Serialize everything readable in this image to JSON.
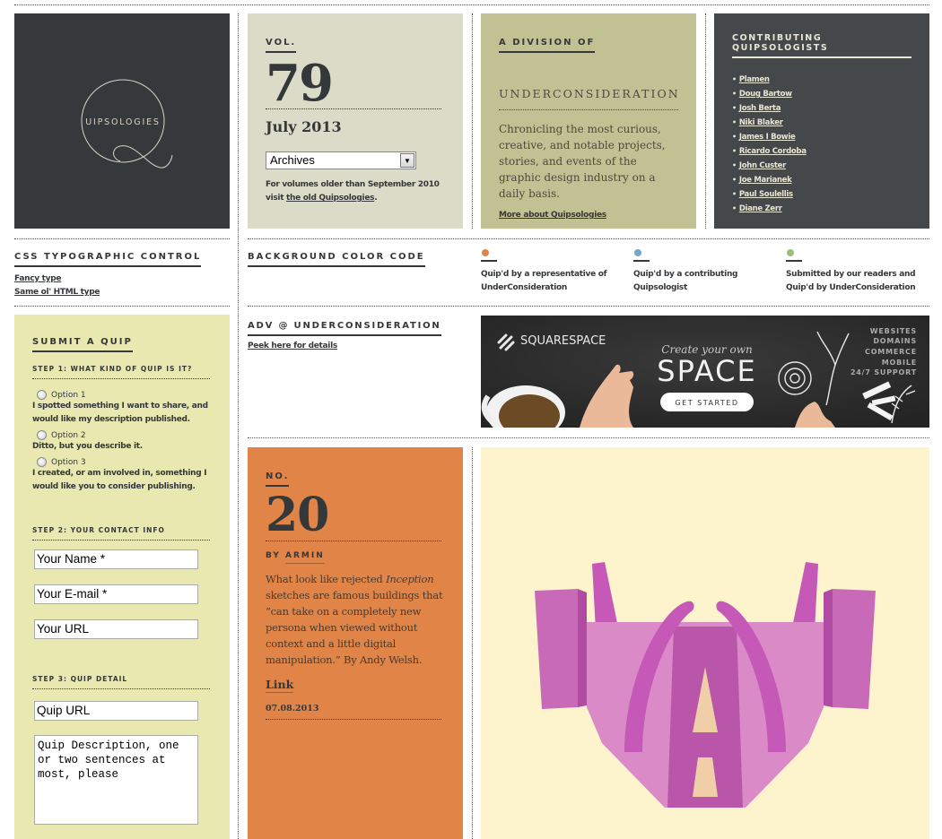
{
  "logo": {
    "text": "UIPSOLOGIES",
    "letter": "Q"
  },
  "volume": {
    "label": "VOL.",
    "number": "79",
    "month": "July 2013",
    "archives_select": {
      "selected": "Archives"
    },
    "note_prefix": "For volumes older than September 2010 visit ",
    "note_link": "the old Quipsologies",
    "note_suffix": "."
  },
  "division": {
    "label": "A DIVISION OF",
    "brand": "UNDERCONSIDERATION",
    "description": "Chronicling the most curious, creative, and notable projects, stories, and events of the graphic design industry on a daily basis.",
    "more_link": "More about Quipsologies"
  },
  "contributors": {
    "label": "CONTRIBUTING QUIPSOLOGISTS",
    "names": [
      "Plamen",
      "Doug Bartow",
      "Josh Berta",
      "Niki Blaker",
      "James I Bowie",
      "Ricardo Cordoba",
      "John Custer",
      "Joe Marianek",
      "Paul Soulellis",
      "Diane Zerr"
    ]
  },
  "css_control": {
    "label": "CSS TYPOGRAPHIC CONTROL",
    "links": [
      "Fancy type",
      "Same ol' HTML type"
    ]
  },
  "background_code": {
    "label": "BACKGROUND COLOR CODE",
    "legend": [
      {
        "color": "#e08448",
        "text": "Quip'd by a representative of UnderConsideration"
      },
      {
        "color": "#72a6cc",
        "text": "Quip'd by a contributing Quipsologist"
      },
      {
        "color": "#9fbd76",
        "text": "Submitted by our readers and Quip'd by UnderConsideration"
      }
    ]
  },
  "submit": {
    "title": "SUBMIT A QUIP",
    "step1": "STEP 1: WHAT KIND OF QUIP IS IT?",
    "options": [
      {
        "label": "Option 1",
        "desc": "I spotted something I want to share, and would like my description published."
      },
      {
        "label": "Option 2",
        "desc": "Ditto, but you describe it."
      },
      {
        "label": "Option 3",
        "desc": "I created, or am involved in, something I would like you to consider publishing."
      }
    ],
    "step2": "STEP 2: YOUR CONTACT INFO",
    "name_value": "Your Name *",
    "email_value": "Your E-mail *",
    "url_value": "Your URL",
    "step3": "STEP 3: QUIP DETAIL",
    "quip_url_value": "Quip URL",
    "quip_desc_value": "Quip Description, one or two sentences at most, please"
  },
  "advertising": {
    "label": "ADV @ UNDERCONSIDERATION",
    "link": "Peek here for details",
    "ad": {
      "brand": "SQUARESPACE",
      "tagline": "Create your own",
      "headline": "SPACE",
      "cta": "GET STARTED",
      "features": [
        "WEBSITES",
        "DOMAINS",
        "COMMERCE",
        "MOBILE",
        "24/7 SUPPORT"
      ]
    }
  },
  "post": {
    "label": "NO.",
    "number": "20",
    "by_prefix": "BY ",
    "author": "ARMIN",
    "body_1": "What look like rejected ",
    "body_em": "Inception",
    "body_2": " sketches are famous buildings that “can take on a completely new persona when viewed without context and a little digital manipulation.” By Andy Welsh.",
    "link": "Link",
    "date": "07.08.2013"
  },
  "colors": {
    "dark": "#36393c",
    "volume_bg": "#dbdcc8",
    "division_bg": "#c2c194",
    "contrib_bg": "#45484b",
    "form_bg": "#e8e8b0",
    "post_bg": "#e08448",
    "art_bg": "#fdf3cc",
    "art_magenta": "#c658b8"
  }
}
